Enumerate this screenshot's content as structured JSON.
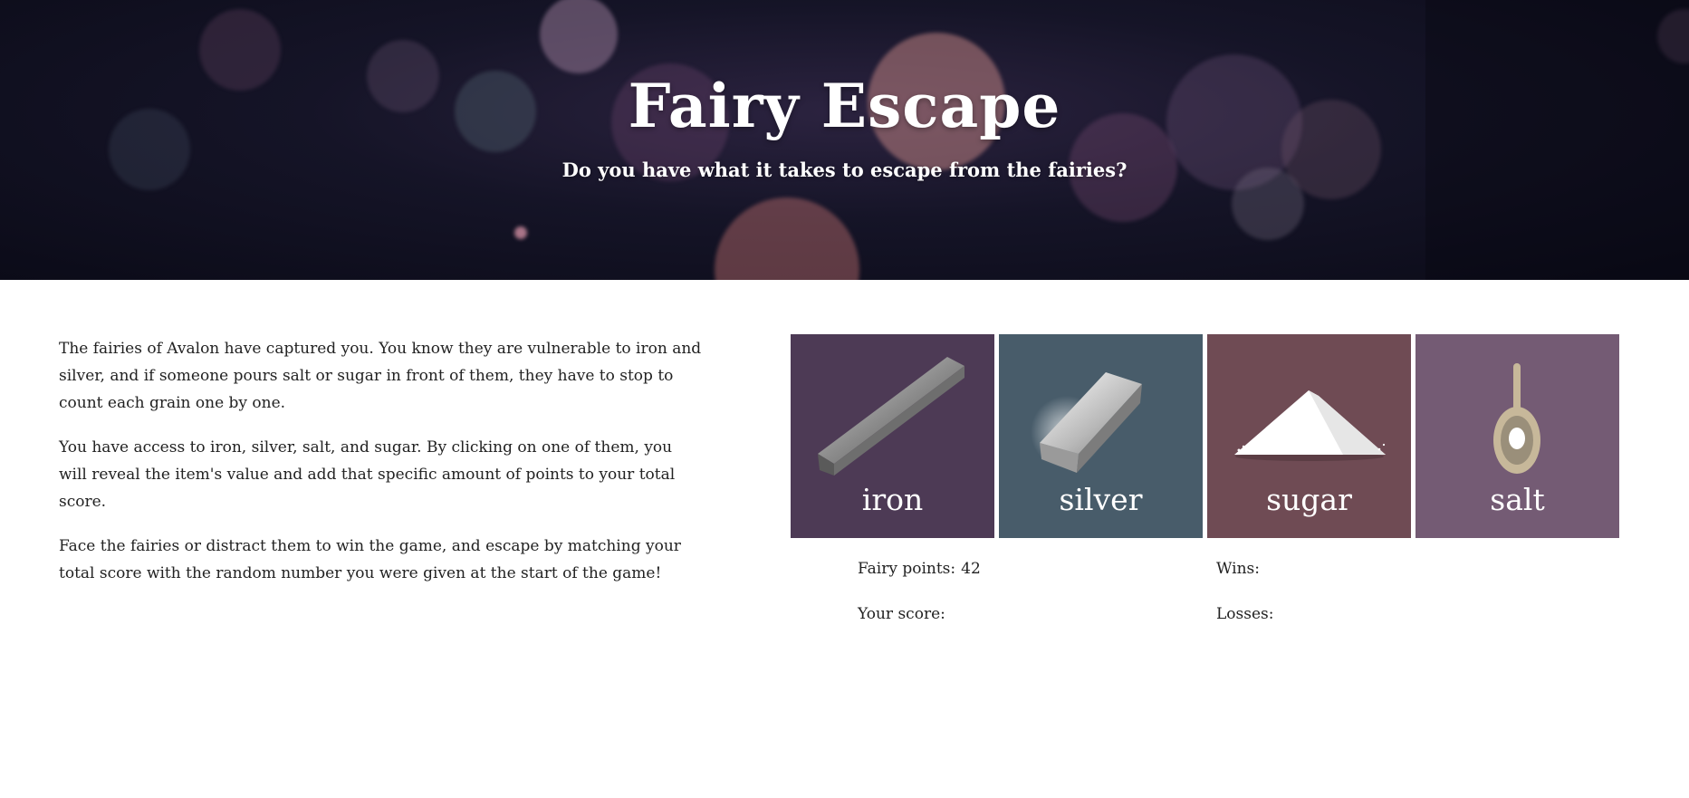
{
  "header": {
    "title": "Fairy Escape",
    "subtitle": "Do you have what it takes to escape from the fairies?"
  },
  "instructions": {
    "paragraphs": [
      "The fairies of Avalon have captured you. You know they are vulnerable to iron and silver, and if someone pours salt or sugar in front of them, they have to stop to count each grain one by one.",
      "You have access to iron, silver, salt, and sugar. By clicking on one of them, you will reveal the item's value and add that specific amount of points to your total score.",
      "Face the fairies or distract them to win the game, and escape by matching your total score with the random number you were given at the start of the game!"
    ]
  },
  "items": [
    {
      "label": "iron",
      "icon": "iron-bar-icon",
      "color": "#4d3a55"
    },
    {
      "label": "silver",
      "icon": "silver-ingot-icon",
      "color": "#485c6a"
    },
    {
      "label": "sugar",
      "icon": "sugar-pile-icon",
      "color": "#6f4b54"
    },
    {
      "label": "salt",
      "icon": "salt-spoon-icon",
      "color": "#745b74"
    }
  ],
  "stats": {
    "fairy_points_label": "Fairy points:",
    "fairy_points_value": "42",
    "your_score_label": "Your score:",
    "your_score_value": "",
    "wins_label": "Wins:",
    "wins_value": "",
    "losses_label": "Losses:",
    "losses_value": ""
  }
}
